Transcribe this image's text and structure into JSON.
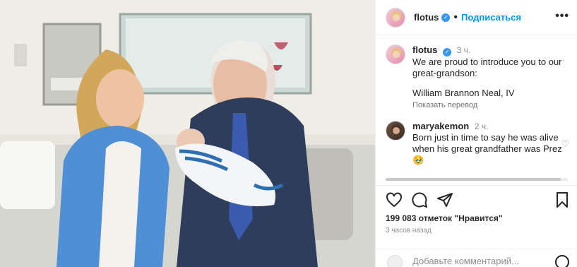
{
  "post": {
    "author": "flotus",
    "follow_label": "Подписаться",
    "more_icon": "more-horizontal-icon",
    "verified_icon": "verified-badge-icon"
  },
  "caption": {
    "author": "flotus",
    "time": "3 ч.",
    "line1": "We are proud to introduce you to our great-grandson:",
    "line2": "William Brannon Neal, IV",
    "translate": "Показать перевод"
  },
  "comment": {
    "author": "maryakemon",
    "time": "2 ч.",
    "text": "Born just in time to say he was alive when his great grandfather was Prez",
    "emoji": "🥹"
  },
  "actions": {
    "icons": [
      "heart-icon",
      "comment-icon",
      "share-icon",
      "bookmark-icon"
    ],
    "likes": "199 083 отметок \"Нравится\"",
    "time_ago": "3 часов назад"
  },
  "add_comment": {
    "placeholder": "Добавьте комментарий..."
  }
}
